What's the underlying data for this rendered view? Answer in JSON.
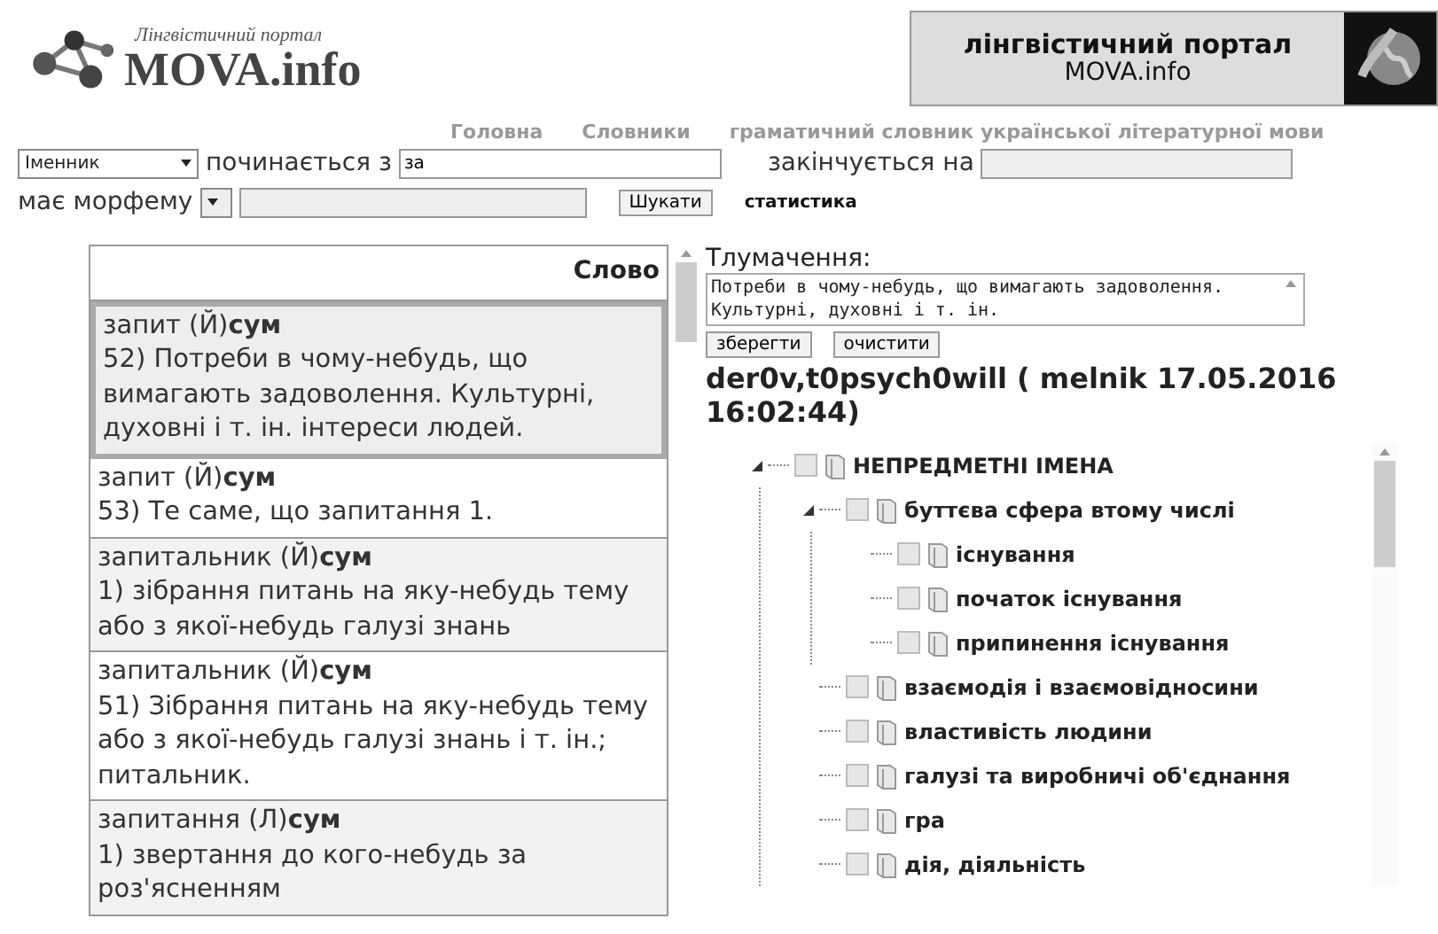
{
  "logo": {
    "subtitle": "Лінгвістичний портал",
    "title": "MOVA.info"
  },
  "banner": {
    "line1": "лінгвістичний портал",
    "line2": "MOVA.info"
  },
  "nav": [
    "Головна",
    "Словники",
    "граматичний словник української літературної мови"
  ],
  "search": {
    "pos": "Іменник",
    "starts_label": "починається з",
    "starts_value": "за",
    "ends_label": "закінчується на",
    "morpheme_label": "має морфему",
    "button": "Шукати",
    "stats_link": "статистика"
  },
  "table": {
    "column": "Слово",
    "rows": [
      {
        "word": "запит",
        "mark": "(Й)",
        "pos": "сум",
        "definition": "52) Потреби в чому-небудь, що вимагають задоволення. Культурні, духовні і т. ін. інтереси людей.",
        "selected": true
      },
      {
        "word": "запит",
        "mark": "(Й)",
        "pos": "сум",
        "definition": "53) Те саме, що запитання 1.",
        "selected": false
      },
      {
        "word": "запитальник",
        "mark": "(Й)",
        "pos": "сум",
        "definition": "1) зібрання питань на яку-небудь тему або з якої-небудь галузі знань",
        "selected": false
      },
      {
        "word": "запитальник",
        "mark": "(Й)",
        "pos": "сум",
        "definition": "51) Зібрання питань на яку-небудь тему або з якої-небудь галузі знань і т. ін.; питальник.",
        "selected": false
      },
      {
        "word": "запитання",
        "mark": "(Л)",
        "pos": "сум",
        "definition": "1) звертання до кого-небудь за роз'ясненням",
        "selected": false
      }
    ]
  },
  "editor": {
    "label": "Тлумачення:",
    "value": "Потреби в чому-небудь, що вимагають задоволення.  Культурні, духовні і т. ін.",
    "save": "зберегти",
    "clear": "очистити",
    "author": "der0v,t0psych0will ( melnik 17.05.2016 16:02:44)"
  },
  "tree": [
    {
      "label": "НЕПРЕДМЕТНІ ІМЕНА",
      "checked": false,
      "expanded": true,
      "children": [
        {
          "label": "буттєва сфера втому числі",
          "checked": false,
          "expanded": true,
          "children": [
            {
              "label": "існування",
              "checked": false
            },
            {
              "label": "початок існування",
              "checked": false
            },
            {
              "label": "припинення існування",
              "checked": false
            }
          ]
        },
        {
          "label": "взаємодія і взаємовідносини",
          "checked": false
        },
        {
          "label": "властивість людини",
          "checked": false
        },
        {
          "label": "галузі та виробничі об'єднання",
          "checked": false
        },
        {
          "label": "гра",
          "checked": false
        },
        {
          "label": "дія, діяльність",
          "checked": false
        }
      ]
    }
  ]
}
